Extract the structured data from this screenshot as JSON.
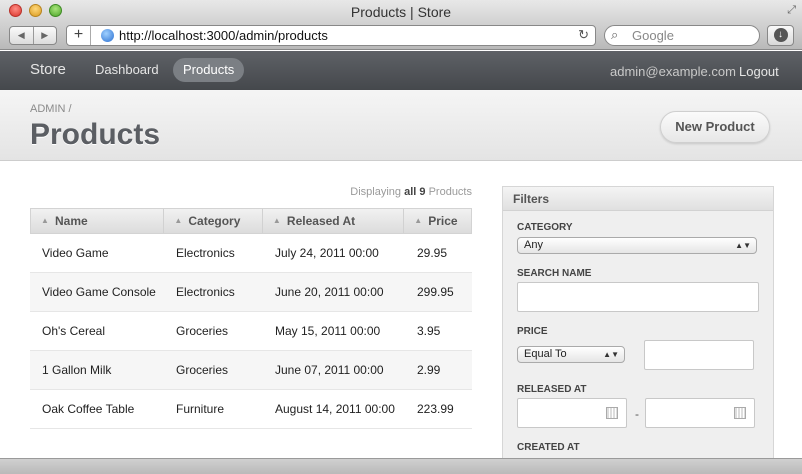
{
  "browser": {
    "window_title": "Products | Store",
    "url": "http://localhost:3000/admin/products",
    "search_placeholder": "Google"
  },
  "nav": {
    "brand": "Store",
    "links": [
      "Dashboard",
      "Products"
    ],
    "active": "Products",
    "user_email": "admin@example.com",
    "logout": "Logout"
  },
  "header": {
    "breadcrumb": "ADMIN",
    "breadcrumb_sep": "/",
    "title": "Products",
    "new_button": "New Product"
  },
  "listing": {
    "displaying_prefix": "Displaying",
    "displaying_all": "all 9",
    "displaying_suffix": "Products",
    "columns": [
      "Name",
      "Category",
      "Released At",
      "Price"
    ],
    "rows": [
      {
        "name": "Video Game",
        "category": "Electronics",
        "released_at": "July 24, 2011 00:00",
        "price": "29.95"
      },
      {
        "name": "Video Game Console",
        "category": "Electronics",
        "released_at": "June 20, 2011 00:00",
        "price": "299.95"
      },
      {
        "name": "Oh's Cereal",
        "category": "Groceries",
        "released_at": "May 15, 2011 00:00",
        "price": "3.95"
      },
      {
        "name": "1 Gallon Milk",
        "category": "Groceries",
        "released_at": "June 07, 2011 00:00",
        "price": "2.99"
      },
      {
        "name": "Oak Coffee Table",
        "category": "Furniture",
        "released_at": "August 14, 2011 00:00",
        "price": "223.99"
      }
    ]
  },
  "filters": {
    "title": "Filters",
    "category_label": "CATEGORY",
    "category_value": "Any",
    "search_name_label": "SEARCH NAME",
    "price_label": "PRICE",
    "price_operator": "Equal To",
    "released_at_label": "RELEASED AT",
    "range_separator": "-",
    "created_at_label": "CREATED AT"
  },
  "colors": {
    "nav_bg": "#4f5256",
    "active_pill": "#7b7f84",
    "title_text": "#5b5e63"
  }
}
